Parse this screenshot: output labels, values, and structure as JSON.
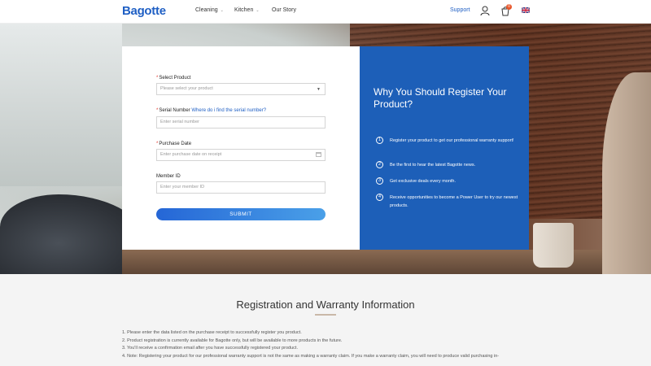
{
  "header": {
    "logo": "Bagotte",
    "nav": [
      "Cleaning",
      "Kitchen",
      "Our Story"
    ],
    "support": "Support",
    "cart_count": "0"
  },
  "form": {
    "product_label": "Select Product",
    "product_placeholder": "Please select your product",
    "serial_label": "Serial Number",
    "serial_link": "Where do i find the serial number?",
    "serial_placeholder": "Enter serial number",
    "date_label": "Purchase Date",
    "date_placeholder": "Enter purchase date on receipt",
    "member_label": "Member ID",
    "member_placeholder": "Enter your member ID",
    "submit": "SUBMIT"
  },
  "info": {
    "title": "Why You Should Register Your Product?",
    "items": [
      {
        "num": "1",
        "text": "Register your product to get our professional warranty support!"
      },
      {
        "num": "2",
        "text": "Be the first to hear the latest Bagotte news."
      },
      {
        "num": "3",
        "text": "Get exclusive deals every month."
      },
      {
        "num": "4",
        "text": "Receive opportunities to become a Power User to try our newest products."
      }
    ]
  },
  "registration": {
    "title": "Registration and Warranty Information",
    "lines": [
      "1. Please enter the data listed on the purchase receipt to successfully register you product.",
      "2. Product registration is currently available for Bagotte only, but will be available to more products in the future.",
      "3. You'll receive a confirmation email after you have successfully registered your product.",
      "4. Note: Registering your product for our professional warranty support is not the same as making a warranty claim. If you make a warranty claim, you will need to produce valid purchasing in-"
    ]
  }
}
